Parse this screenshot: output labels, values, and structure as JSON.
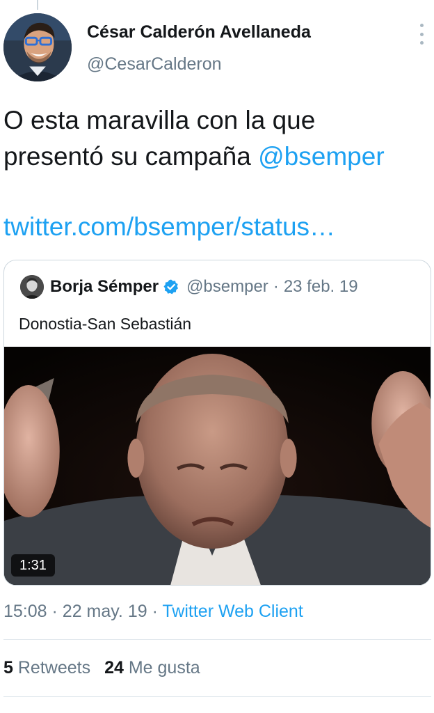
{
  "tweet": {
    "author": {
      "name": "César Calderón Avellaneda",
      "handle": "@CesarCalderon"
    },
    "text_line1": "O esta maravilla con la que",
    "text_line2_prefix": "presentó su campaña ",
    "mention": "@bsemper",
    "link": "twitter.com/bsemper/status…",
    "quoted": {
      "name": "Borja Sémper",
      "verified": true,
      "handle": "@bsemper",
      "separator": "·",
      "date": "23 feb. 19",
      "text": "Donostia-San Sebastián",
      "video_duration": "1:31"
    },
    "time": "15:08",
    "separator": "·",
    "date": "22 may. 19",
    "client": "Twitter Web Client",
    "stats": {
      "retweets_count": "5",
      "retweets_label": "Retweets",
      "likes_count": "24",
      "likes_label": "Me gusta"
    }
  },
  "icons": {
    "more": "more-vertical-icon",
    "verified": "verified-badge-icon"
  },
  "colors": {
    "accent": "#1da1f2",
    "secondary_text": "#657786",
    "primary_text": "#14171a",
    "border": "#ccd6dd"
  }
}
